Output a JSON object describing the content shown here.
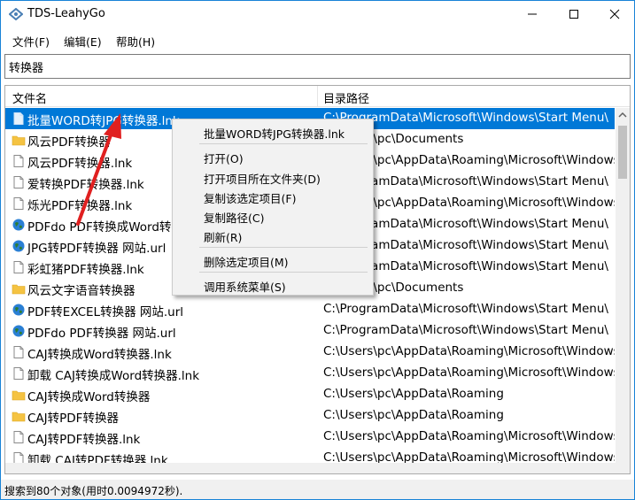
{
  "window": {
    "title": "TDS-LeahyGo"
  },
  "menubar": {
    "items": [
      "文件(F)",
      "编辑(E)",
      "帮助(H)"
    ]
  },
  "search": {
    "value": "转换器"
  },
  "list": {
    "columns": [
      "文件名",
      "目录路径"
    ],
    "rows": [
      {
        "name": "批量WORD转JPG转换器.lnk",
        "path": "C:\\ProgramData\\Microsoft\\Windows\\Start Menu\\",
        "icon": "shortcut-file-icon",
        "selected": true
      },
      {
        "name": "风云PDF转换器",
        "path": "C:\\Users\\pc\\Documents",
        "icon": "folder-icon"
      },
      {
        "name": "风云PDF转换器.lnk",
        "path": "C:\\Users\\pc\\AppData\\Roaming\\Microsoft\\Windows",
        "icon": "shortcut-file-icon"
      },
      {
        "name": "爱转换PDF转换器.lnk",
        "path": "C:\\ProgramData\\Microsoft\\Windows\\Start Menu\\",
        "icon": "shortcut-file-icon"
      },
      {
        "name": "烁光PDF转换器.lnk",
        "path": "C:\\Users\\pc\\AppData\\Roaming\\Microsoft\\Windows",
        "icon": "shortcut-file-icon"
      },
      {
        "name": "PDFdo PDF转换成Word转换器",
        "path": "C:\\ProgramData\\Microsoft\\Windows\\Start Menu\\",
        "icon": "globe-icon"
      },
      {
        "name": "JPG转PDF转换器 网站.url",
        "path": "C:\\ProgramData\\Microsoft\\Windows\\Start Menu\\",
        "icon": "globe-icon"
      },
      {
        "name": "彩虹猪PDF转换器.lnk",
        "path": "C:\\ProgramData\\Microsoft\\Windows\\Start Menu\\",
        "icon": "shortcut-file-icon"
      },
      {
        "name": "风云文字语音转换器",
        "path": "C:\\Users\\pc\\Documents",
        "icon": "folder-icon"
      },
      {
        "name": "PDF转EXCEL转换器 网站.url",
        "path": "C:\\ProgramData\\Microsoft\\Windows\\Start Menu\\",
        "icon": "globe-icon"
      },
      {
        "name": "PDFdo PDF转换器 网站.url",
        "path": "C:\\ProgramData\\Microsoft\\Windows\\Start Menu\\",
        "icon": "globe-icon"
      },
      {
        "name": "CAJ转换成Word转换器.lnk",
        "path": "C:\\Users\\pc\\AppData\\Roaming\\Microsoft\\Windows",
        "icon": "shortcut-file-icon"
      },
      {
        "name": "卸载 CAJ转换成Word转换器.lnk",
        "path": "C:\\Users\\pc\\AppData\\Roaming\\Microsoft\\Windows",
        "icon": "shortcut-file-icon"
      },
      {
        "name": "CAJ转换成Word转换器",
        "path": "C:\\Users\\pc\\AppData\\Roaming",
        "icon": "folder-icon"
      },
      {
        "name": "CAJ转PDF转换器",
        "path": "C:\\Users\\pc\\AppData\\Roaming",
        "icon": "folder-icon"
      },
      {
        "name": "CAJ转PDF转换器.lnk",
        "path": "C:\\Users\\pc\\AppData\\Roaming\\Microsoft\\Windows",
        "icon": "shortcut-file-icon"
      },
      {
        "name": "卸载 CAJ转PDF转换器.lnk",
        "path": "C:\\Users\\pc\\AppData\\Roaming\\Microsoft\\Windows",
        "icon": "shortcut-file-icon"
      }
    ]
  },
  "context_menu": {
    "items": [
      "批量WORD转JPG转换器.lnk",
      "打开(O)",
      "打开项目所在文件夹(D)",
      "复制该选定项目(F)",
      "复制路径(C)",
      "刷新(R)",
      "删除选定项目(M)",
      "调用系统菜单(S)"
    ]
  },
  "status": {
    "text": "搜索到80个对象(用时0.0094972秒)."
  },
  "colors": {
    "accent": "#0078d7",
    "annotation_arrow": "#e02020",
    "folder": "#f5c342",
    "globe": "#2e7d32"
  }
}
